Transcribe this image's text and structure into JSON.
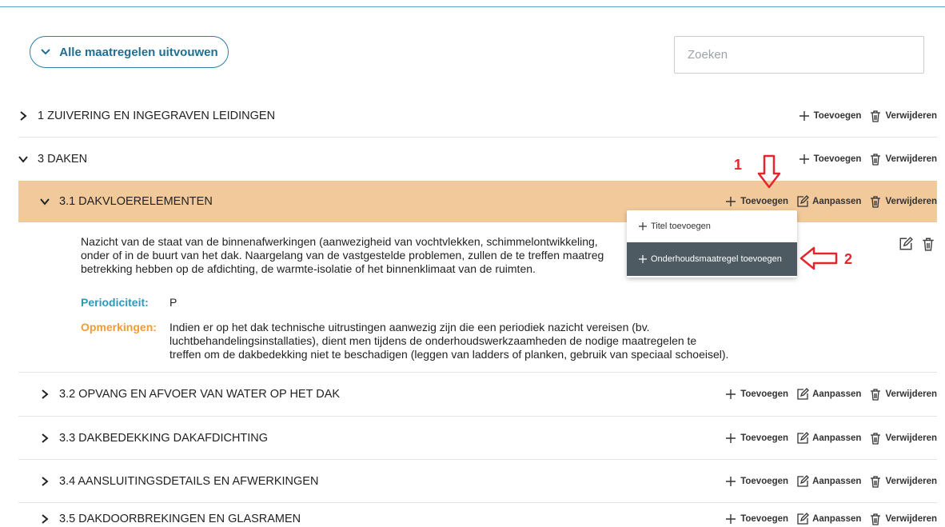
{
  "toolbar": {
    "expand_all_label": "Alle maatregelen uitvouwen",
    "search_placeholder": "Zoeken"
  },
  "actions": {
    "add": "Toevoegen",
    "edit": "Aanpassen",
    "delete": "Verwijderen"
  },
  "sections": [
    {
      "title": "1 ZUIVERING EN INGEGRAVEN LEIDINGEN",
      "expanded": false
    },
    {
      "title": "3 DAKEN",
      "expanded": true
    }
  ],
  "subsections": [
    {
      "title": "3.1 DAKVLOERELEMENTEN",
      "expanded": true,
      "highlighted": true
    },
    {
      "title": "3.2 OPVANG EN AFVOER VAN WATER OP HET DAK",
      "expanded": false
    },
    {
      "title": "3.3 DAKBEDEKKING DAKAFDICHTING",
      "expanded": false
    },
    {
      "title": "3.4 AANSLUITINGSDETAILS EN AFWERKINGEN",
      "expanded": false
    },
    {
      "title": "3.5 DAKDOORBREKINGEN EN GLASRAMEN",
      "expanded": false
    }
  ],
  "measure": {
    "description_lines": [
      "Nazicht van de staat van de binnenafwerkingen (aanwezigheid van vochtvlekken, schimmelontwikkeling,",
      "onder of in de buurt van het dak. Naargelang van de vastgestelde problemen, zullen de te treffen maatreg",
      "betrekking hebben op de afdichting, de warmte-isolatie of het binnenklimaat van de ruimten."
    ],
    "periodicity_label": "Periodiciteit:",
    "periodicity_value": "P",
    "remarks_label": "Opmerkingen:",
    "remarks_lines": [
      "Indien er op het dak technische uitrustingen aanwezig zijn die een periodiek nazicht vereisen (bv.",
      "luchtbehandelingsinstallaties), dient men tijdens de onderhoudswerkzaamheden de nodige maatregelen te",
      "treffen om de dakbedekking niet te beschadigen (leggen van ladders of planken, gebruik van speciaal schoeisel)."
    ]
  },
  "dropdown": {
    "items": [
      "Titel toevoegen",
      "Onderhoudsmaatregel toevoegen"
    ],
    "active_index": 1
  },
  "markers": {
    "first": "1",
    "second": "2"
  },
  "colors": {
    "accent": "#1f6f93",
    "highlight": "#f2c99a",
    "marker": "#e3262b",
    "periodicity": "#2f97b8",
    "remarks": "#f29b33"
  }
}
